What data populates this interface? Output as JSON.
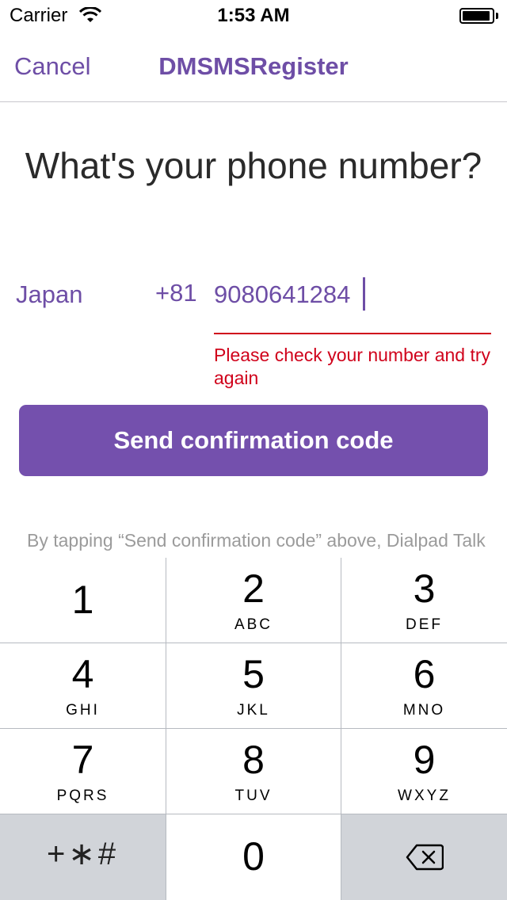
{
  "status_bar": {
    "carrier": "Carrier",
    "time": "1:53 AM",
    "battery_level": 0.95
  },
  "nav": {
    "cancel_label": "Cancel",
    "title": "DMSMSRegister"
  },
  "form": {
    "headline": "What's your phone number?",
    "country": "Japan",
    "dial_code": "+81",
    "phone_value": "9080641284",
    "error": "Please check your number and try again",
    "send_button": "Send confirmation code",
    "legal": "By tapping “Send confirmation code” above, Dialpad Talk will send you an SMS to confirm your phone number."
  },
  "keypad": {
    "keys": [
      {
        "digit": "1",
        "letters": ""
      },
      {
        "digit": "2",
        "letters": "ABC"
      },
      {
        "digit": "3",
        "letters": "DEF"
      },
      {
        "digit": "4",
        "letters": "GHI"
      },
      {
        "digit": "5",
        "letters": "JKL"
      },
      {
        "digit": "6",
        "letters": "MNO"
      },
      {
        "digit": "7",
        "letters": "PQRS"
      },
      {
        "digit": "8",
        "letters": "TUV"
      },
      {
        "digit": "9",
        "letters": "WXYZ"
      }
    ],
    "symbols": "+∗#",
    "zero": "0",
    "backspace_icon": "backspace-icon"
  },
  "colors": {
    "accent": "#6e4ea6",
    "button": "#7450ad",
    "error": "#d0021b",
    "keypad_bg": "#b6bac0"
  }
}
